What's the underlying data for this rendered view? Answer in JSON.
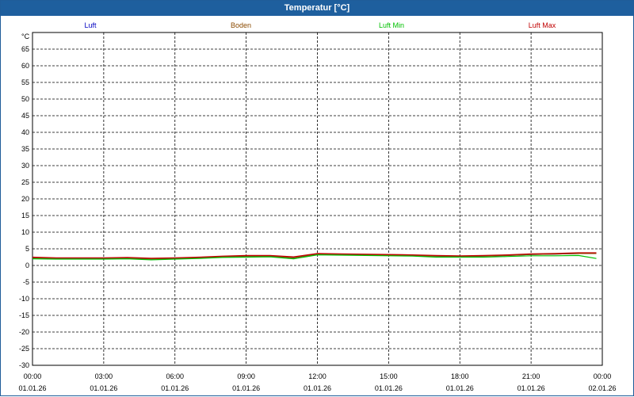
{
  "window": {
    "title": "Temperatur [°C]"
  },
  "chart_data": {
    "type": "line",
    "title": "Temperatur [°C]",
    "ylabel": "°C",
    "xlabel": "",
    "ylim": [
      -30,
      70
    ],
    "yticks": [
      65,
      60,
      55,
      50,
      45,
      40,
      35,
      30,
      25,
      20,
      15,
      10,
      5,
      0,
      -5,
      -10,
      -15,
      -20,
      -25,
      -30
    ],
    "xlim": [
      "00:00",
      "00:00"
    ],
    "xticks": [
      {
        "time": "00:00",
        "date": "01.01.26"
      },
      {
        "time": "03:00",
        "date": "01.01.26"
      },
      {
        "time": "06:00",
        "date": "01.01.26"
      },
      {
        "time": "09:00",
        "date": "01.01.26"
      },
      {
        "time": "12:00",
        "date": "01.01.26"
      },
      {
        "time": "15:00",
        "date": "01.01.26"
      },
      {
        "time": "18:00",
        "date": "01.01.26"
      },
      {
        "time": "21:00",
        "date": "01.01.26"
      },
      {
        "time": "00:00",
        "date": "02.01.26"
      }
    ],
    "grid": true,
    "legend_position": "top",
    "x": [
      "00:00",
      "01:00",
      "02:00",
      "03:00",
      "04:00",
      "05:00",
      "06:00",
      "07:00",
      "08:00",
      "09:00",
      "10:00",
      "11:00",
      "12:00",
      "13:00",
      "14:00",
      "15:00",
      "16:00",
      "17:00",
      "18:00",
      "19:00",
      "20:00",
      "21:00",
      "22:00",
      "23:00",
      "23:45"
    ],
    "series": [
      {
        "name": "Luft",
        "color": "#0000c0",
        "values": [
          2.3,
          2.1,
          2.1,
          2.1,
          2.2,
          2.0,
          2.1,
          2.3,
          2.6,
          2.8,
          2.8,
          2.3,
          3.4,
          3.3,
          3.2,
          3.1,
          3.0,
          2.8,
          2.7,
          2.8,
          3.0,
          3.3,
          3.4,
          3.6,
          3.6
        ]
      },
      {
        "name": "Boden",
        "color": "#8b4a00",
        "values": [
          2.3,
          2.1,
          2.1,
          2.1,
          2.2,
          2.0,
          2.1,
          2.3,
          2.6,
          2.8,
          2.8,
          2.3,
          3.4,
          3.3,
          3.2,
          3.1,
          3.0,
          2.8,
          2.7,
          2.8,
          3.0,
          3.3,
          3.4,
          3.6,
          3.6
        ]
      },
      {
        "name": "Luft Min",
        "color": "#00c000",
        "values": [
          2.0,
          1.9,
          1.9,
          1.9,
          2.0,
          1.7,
          1.9,
          2.1,
          2.4,
          2.5,
          2.6,
          2.0,
          3.2,
          3.1,
          3.0,
          2.9,
          2.8,
          2.5,
          2.5,
          2.5,
          2.7,
          2.9,
          2.9,
          3.0,
          2.1
        ]
      },
      {
        "name": "Luft Max",
        "color": "#c00000",
        "values": [
          2.5,
          2.3,
          2.3,
          2.3,
          2.4,
          2.2,
          2.3,
          2.5,
          2.8,
          3.0,
          3.0,
          2.6,
          3.6,
          3.5,
          3.4,
          3.3,
          3.2,
          3.0,
          2.9,
          3.0,
          3.2,
          3.5,
          3.6,
          3.8,
          3.8
        ]
      }
    ]
  }
}
